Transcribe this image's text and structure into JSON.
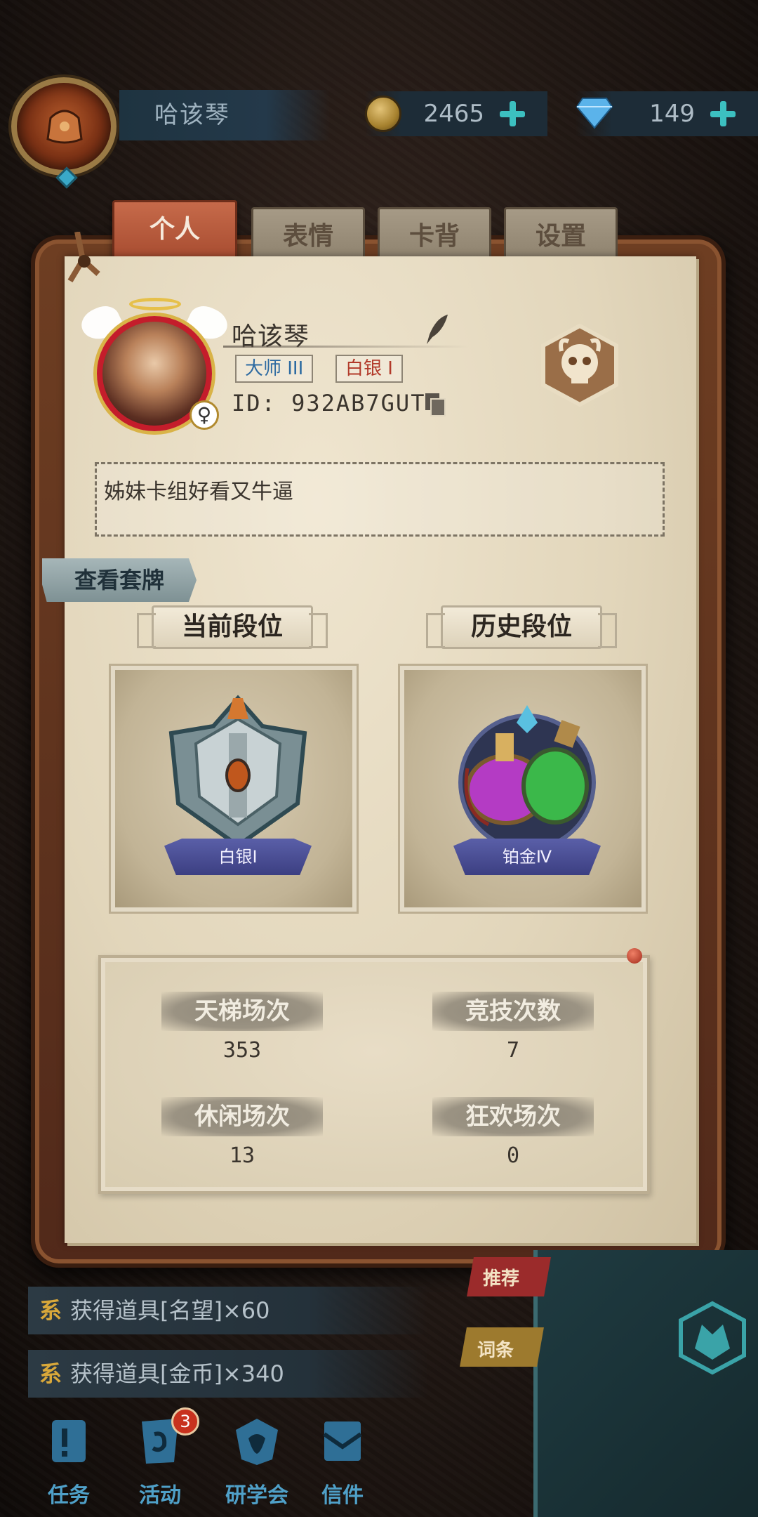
{
  "topbar": {
    "player_name": "哈该琴",
    "gold_value": "2465",
    "gem_value": "149"
  },
  "tabs": [
    {
      "label": "个人",
      "active": true
    },
    {
      "label": "表情",
      "active": false
    },
    {
      "label": "卡背",
      "active": false
    },
    {
      "label": "设置",
      "active": false
    }
  ],
  "profile": {
    "name": "哈该琴",
    "rank_tag_1": "大师 III",
    "rank_tag_2": "白银 I",
    "id_text": "ID: 932AB7GUT",
    "signature": "姊妹卡组好看又牛逼",
    "view_deck_label": "查看套牌"
  },
  "ranks": {
    "current_title": "当前段位",
    "history_title": "历史段位",
    "current_label": "白银Ⅰ",
    "history_label": "铂金Ⅳ"
  },
  "stats": {
    "ladder_label": "天梯场次",
    "ladder_value": "353",
    "arena_label": "竞技次数",
    "arena_value": "7",
    "casual_label": "休闲场次",
    "casual_value": "13",
    "carnival_label": "狂欢场次",
    "carnival_value": "0"
  },
  "messages": [
    {
      "tag": "系",
      "text": "获得道具[名望]×60"
    },
    {
      "tag": "系",
      "text": "获得道具[金币]×340"
    }
  ],
  "side_ribbons": {
    "red": "推荐",
    "gold": "词条"
  },
  "nav": [
    {
      "label": "任务",
      "icon": "scroll-icon"
    },
    {
      "label": "活动",
      "icon": "activity-icon",
      "badge": "3"
    },
    {
      "label": "研学会",
      "icon": "academy-icon"
    },
    {
      "label": "信件",
      "icon": "mail-icon"
    }
  ],
  "colors": {
    "accent_tab": "#b04f30",
    "nav_text": "#4fa0c8",
    "badge_red": "#c8321e"
  }
}
